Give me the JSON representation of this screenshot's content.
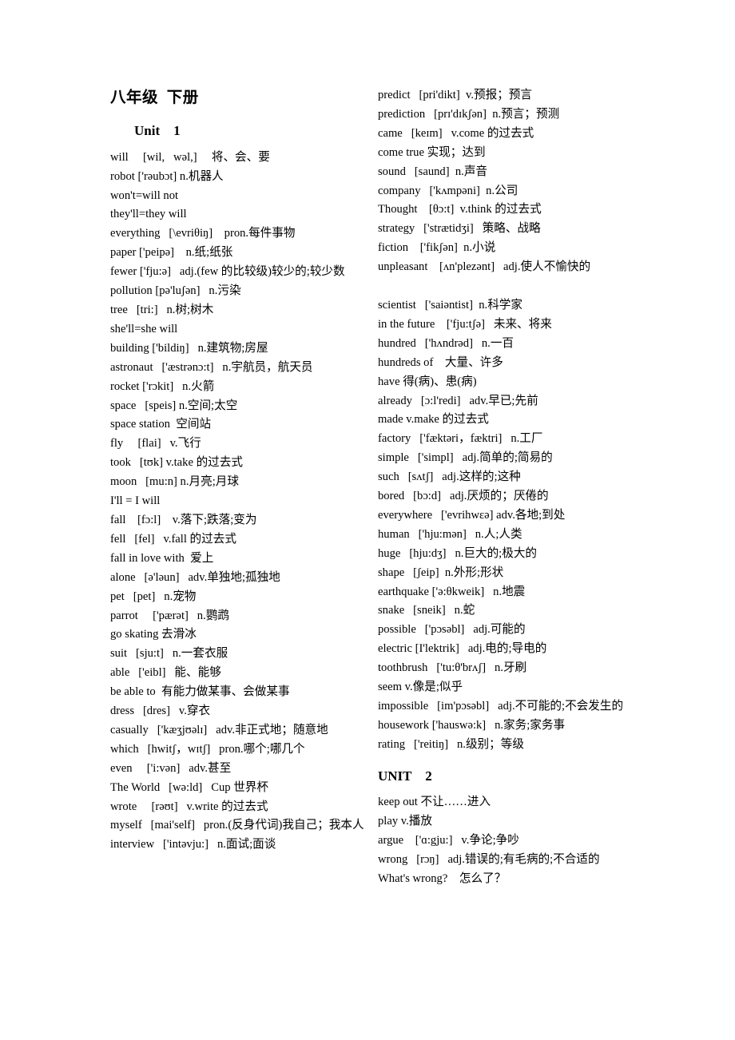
{
  "document": {
    "title": "八年级  下册"
  },
  "columns": {
    "left": {
      "unit_heading": "Unit    1",
      "entries": [
        "will     [wil,   wəl,]     将、会、要",
        "robot ['rəubɔt] n.机器人",
        "won't=will not",
        "they'll=they will",
        "everything   [\\evriθiŋ]    pron.每件事物",
        "paper ['peipə]    n.纸;纸张",
        "fewer ['fju:ə]   adj.(few 的比较级)较少的;较少数",
        "pollution [pə'luʃən]   n.污染",
        "tree   [tri:]   n.树;树木",
        "she'll=she will",
        "building ['bildiŋ]   n.建筑物;房屋",
        "astronaut   ['æstrənɔ:t]   n.宇航员，航天员",
        "rocket ['rɔkit]   n.火箭",
        "space   [speis] n.空间;太空",
        "space station  空间站",
        "fly     [flai]   v.飞行",
        "took   [tʊk] v.take 的过去式",
        "moon   [mu:n] n.月亮;月球",
        "I'll = I will",
        "fall    [fɔ:l]    v.落下;跌落;变为",
        "fell   [fel]   v.fall 的过去式",
        "fall in love with  爱上",
        "alone   [ə'ləun]   adv.单独地;孤独地",
        "pet   [pet]   n.宠物",
        "parrot     ['pærət]   n.鹦鹉",
        "go skating 去滑冰",
        "suit   [sju:t]   n.一套衣服",
        "able   ['eibl]   能、能够",
        "be able to  有能力做某事、会做某事",
        "dress   [dres]   v.穿衣",
        "casually   ['kæʒjʊəlɪ]   adv.非正式地；随意地",
        "which   [hwitʃ，wɪtʃ]   pron.哪个;哪几个",
        "even     ['i:vən]   adv.甚至",
        "The World   [wə:ld]   Cup 世界杯",
        "wrote     [rəʊt]   v.write 的过去式",
        "myself   [mai'self]   pron.(反身代词)我自己；我本人",
        "interview   ['intəvju:]   n.面试;面谈"
      ]
    },
    "right": {
      "unit_heading": "UNIT    2",
      "entries_before_heading": [
        "predict   [pri'dikt]  v.预报；预言",
        "prediction   [prɪ'dɪkʃən]  n.预言；预测",
        "came   [keɪm]   v.come 的过去式",
        "come true 实现；达到",
        "sound   [saund]  n.声音",
        "company   ['kʌmpəni]  n.公司",
        "Thought    [θɔ:t]  v.think 的过去式",
        "strategy   ['strætidʒi]   策略、战略",
        "fiction    ['fikʃən]  n.小说",
        "unpleasant    [ʌn'plezənt]   adj.使人不愉快的",
        "",
        "scientist   ['saiəntist]  n.科学家",
        "in the future    ['fju:tʃə]   未来、将来",
        "hundred   ['hʌndrəd]   n.一百",
        "hundreds of    大量、许多",
        "have 得(病)、患(病)",
        "already   [ɔ:l'redi]   adv.早已;先前",
        "made v.make 的过去式",
        "factory   ['fæktəri，fæktri]   n.工厂",
        "simple   ['simpl]   adj.简单的;简易的",
        "such   [sʌtʃ]   adj.这样的;这种",
        "bored   [bɔ:d]   adj.厌烦的；厌倦的",
        "everywhere   ['evrihwɛə] adv.各地;到处",
        "human   ['hju:mən]   n.人;人类",
        "huge   [hju:dʒ]   n.巨大的;极大的",
        "shape   [ʃeip]  n.外形;形状",
        "earthquake ['ə:θkweik]   n.地震",
        "snake   [sneik]   n.蛇",
        "possible   ['pɔsəbl]   adj.可能的",
        "electric [I'lektrik]   adj.电的;导电的",
        "toothbrush   ['tu:θ'brʌʃ]   n.牙刷",
        "seem v.像是;似乎",
        "impossible   [im'pɔsəbl]   adj.不可能的;不会发生的",
        "housework ['hauswə:k]   n.家务;家务事",
        "rating   ['reitiŋ]   n.级别；等级"
      ],
      "entries_after_heading": [
        "keep out 不让……进入",
        "play v.播放",
        "argue    ['ɑ:gju:]   v.争论;争吵",
        "wrong   [rɔŋ]   adj.错误的;有毛病的;不合适的",
        "What's wrong?    怎么了？"
      ]
    }
  }
}
